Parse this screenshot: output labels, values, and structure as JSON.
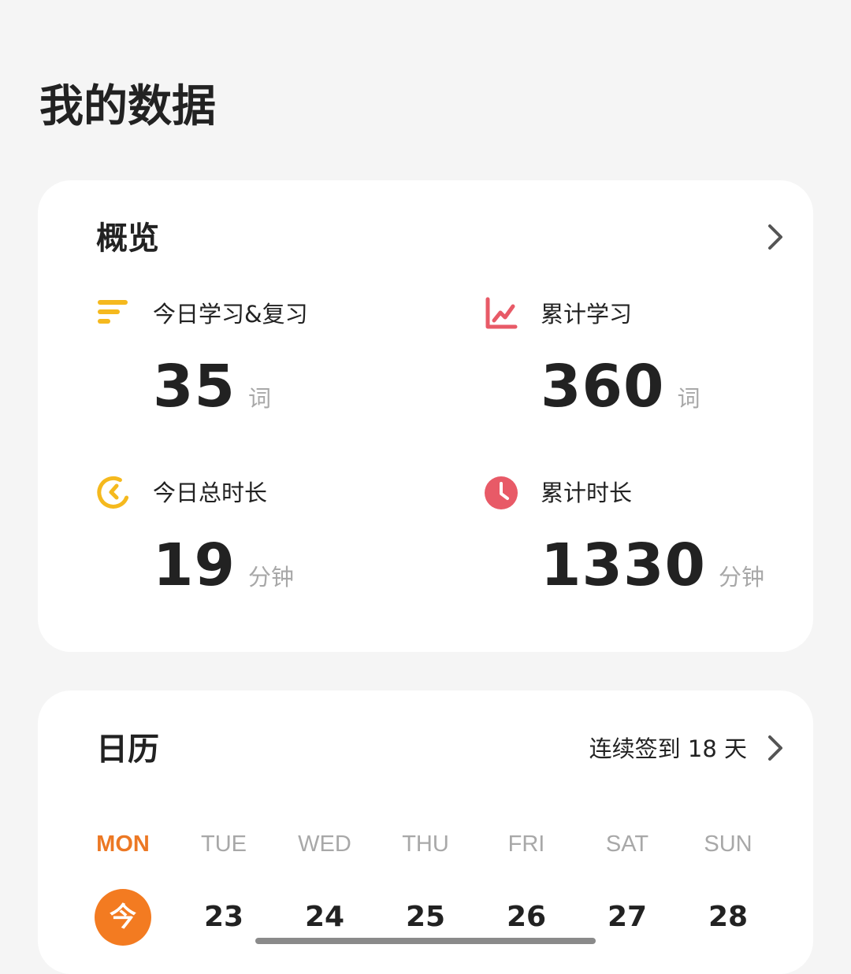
{
  "page": {
    "title": "我的数据"
  },
  "overview": {
    "title": "概览",
    "stats": [
      {
        "icon": "bars-icon",
        "label": "今日学习&复习",
        "value": "35",
        "unit": "词",
        "color": "#f5b91e"
      },
      {
        "icon": "line-chart-icon",
        "label": "累计学习",
        "value": "360",
        "unit": "词",
        "color": "#e85a67"
      },
      {
        "icon": "timer-icon",
        "label": "今日总时长",
        "value": "19",
        "unit": "分钟",
        "color": "#f5b91e"
      },
      {
        "icon": "clock-icon",
        "label": "累计时长",
        "value": "1330",
        "unit": "分钟",
        "color": "#e85a67"
      }
    ]
  },
  "calendar": {
    "title": "日历",
    "streak": "连续签到 18 天",
    "weekdays": [
      "MON",
      "TUE",
      "WED",
      "THU",
      "FRI",
      "SAT",
      "SUN"
    ],
    "today_label": "今",
    "days": [
      "23",
      "24",
      "25",
      "26",
      "27",
      "28"
    ],
    "accent_color": "#f37b21"
  }
}
